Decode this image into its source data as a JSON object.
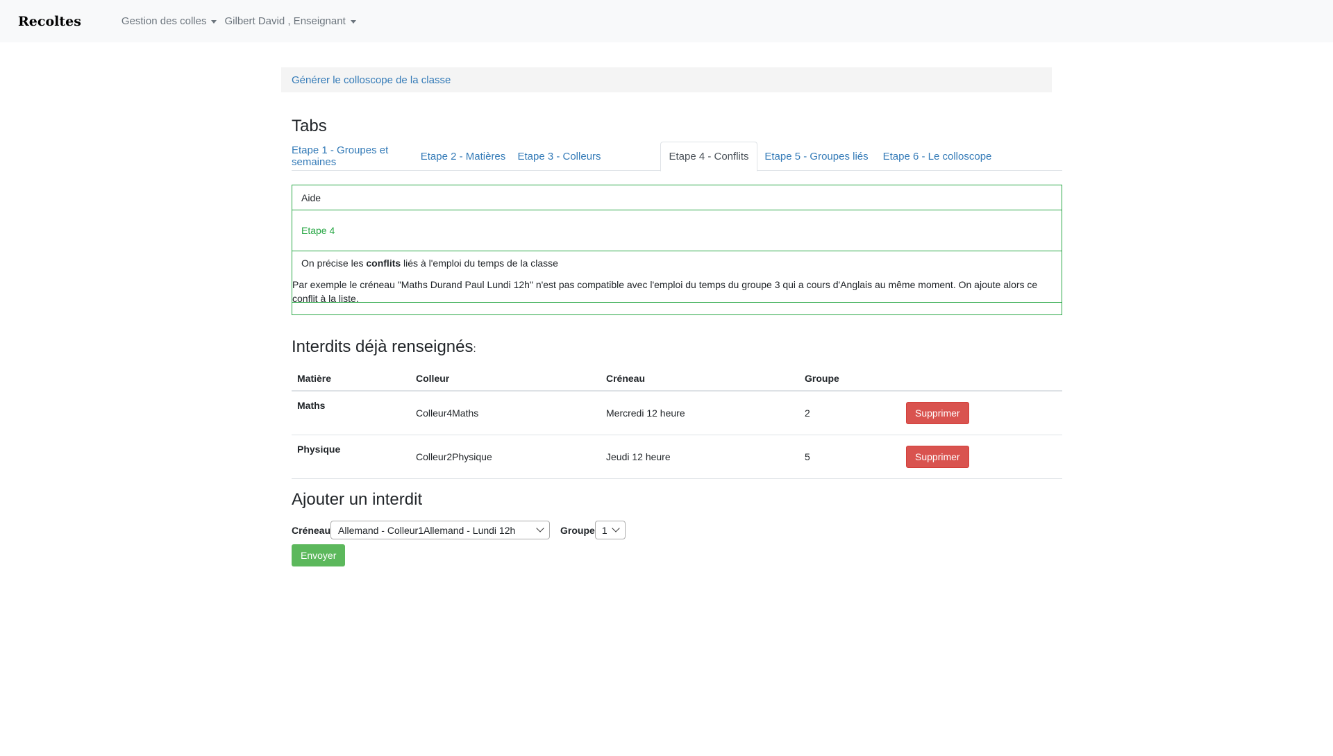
{
  "navbar": {
    "brand": "Recoltes",
    "menu1": "Gestion des colles",
    "menu2": "Gilbert David , Enseignant"
  },
  "generate_link": "Générer le colloscope de la classe",
  "tabs_title": "Tabs",
  "tabs": [
    {
      "label": "Etape 1 - Groupes et semaines"
    },
    {
      "label": "Etape 2 - Matières"
    },
    {
      "label": "Etape 3 - Colleurs"
    },
    {
      "label": "Etape 4 - Conflits",
      "active": true
    },
    {
      "label": "Etape 5 - Groupes liés"
    },
    {
      "label": "Etape 6 - Le colloscope"
    }
  ],
  "help": {
    "header": "Aide",
    "step": "Etape 4",
    "line1_before": "On précise les ",
    "line1_bold": "conflits",
    "line1_after": " liés à l'emploi du temps de la classe",
    "line2": "Par exemple le créneau \"Maths Durand Paul Lundi 12h\" n'est pas compatible avec l'emploi du temps du groupe 3 qui a cours d'Anglais au même moment. On ajoute alors ce conflit à la liste."
  },
  "existing": {
    "title": "Interdits déjà renseignés",
    "title_suffix": ":",
    "columns": [
      "Matière",
      "Colleur",
      "Créneau",
      "Groupe"
    ],
    "rows": [
      {
        "matiere": "Maths",
        "colleur": "Colleur4Maths",
        "creneau": "Mercredi 12 heure",
        "groupe": "2",
        "action": "Supprimer"
      },
      {
        "matiere": "Physique",
        "colleur": "Colleur2Physique",
        "creneau": "Jeudi 12 heure",
        "groupe": "5",
        "action": "Supprimer"
      }
    ]
  },
  "add": {
    "title": "Ajouter un interdit",
    "creneau_label": "Créneau",
    "creneau_value": "Allemand - Colleur1Allemand - Lundi 12h",
    "groupe_label": "Groupe",
    "groupe_value": "1",
    "submit": "Envoyer"
  },
  "colors": {
    "link": "#337ab7",
    "success": "#28a745",
    "danger": "#d9534f",
    "button_success": "#5cb85c"
  }
}
